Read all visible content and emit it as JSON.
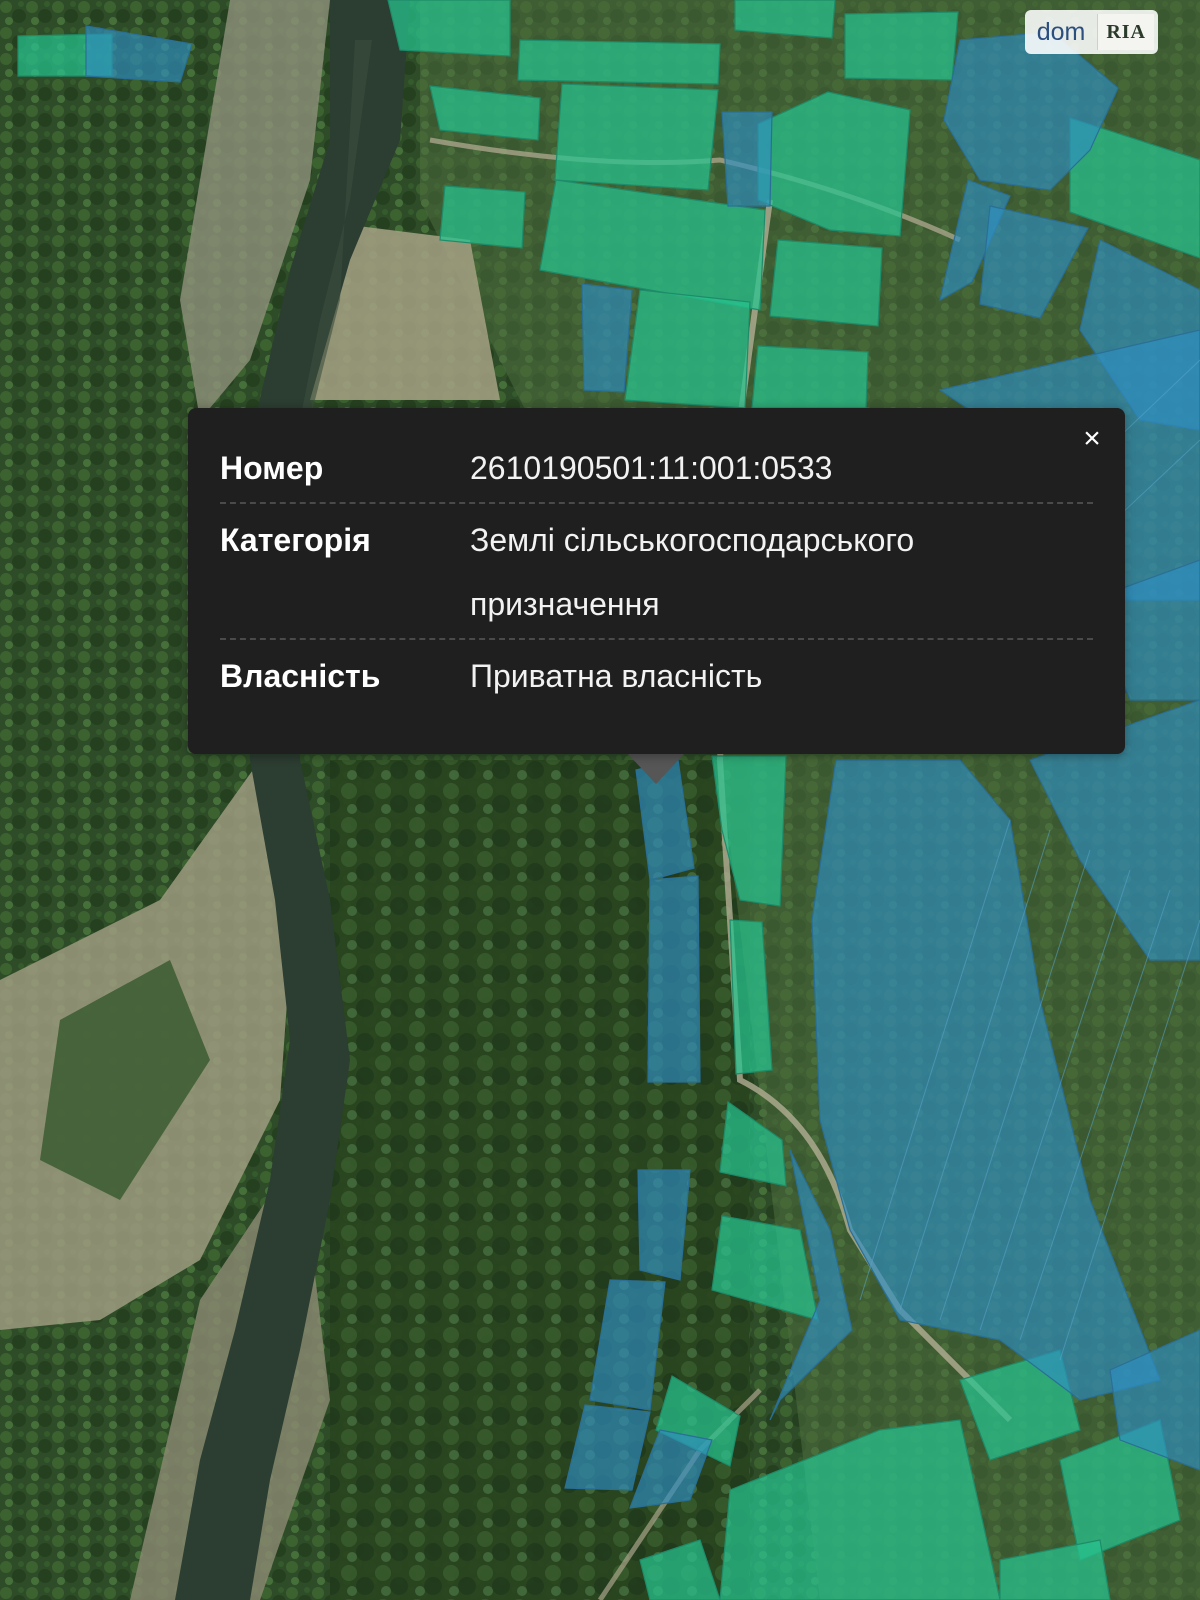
{
  "watermark": {
    "brand_left": "dom",
    "brand_right": "RIA"
  },
  "popup": {
    "close_label": "×",
    "rows": [
      {
        "key": "Номер",
        "value": "2610190501:11:001:0533"
      },
      {
        "key": "Категорія",
        "value": "Землі сільськогосподарського призначення"
      },
      {
        "key": "Власність",
        "value": "Приватна власність"
      }
    ]
  },
  "colors": {
    "parcel_green": "#27c48f",
    "parcel_blue": "#2f8fc2",
    "popup_bg": "#1f1f1f",
    "forest": "#2c4a26",
    "river": "#2e3f33",
    "sandbar": "#9c9a7c"
  }
}
